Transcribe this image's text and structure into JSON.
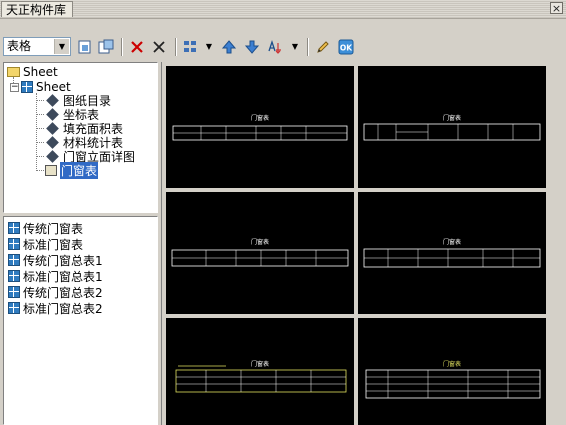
{
  "window": {
    "title": "天正构件库",
    "close_glyph": "×"
  },
  "toolbar": {
    "category_value": "表格",
    "buttons": [
      {
        "name": "import-icon"
      },
      {
        "name": "export-icon"
      },
      {
        "name": "delete-icon",
        "color": "#cc0000"
      },
      {
        "name": "cut-icon"
      },
      {
        "name": "grid-view-icon"
      },
      {
        "name": "move-up-icon"
      },
      {
        "name": "move-down-icon"
      },
      {
        "name": "sort-az-icon"
      },
      {
        "name": "edit-pencil-icon"
      },
      {
        "name": "ok-icon",
        "label": "OK"
      }
    ]
  },
  "tree": {
    "root": "Sheet",
    "child": "Sheet",
    "items": [
      "图纸目录",
      "坐标表",
      "填充面积表",
      "材料统计表",
      "门窗立面详图",
      "门窗表"
    ],
    "selected": "门窗表"
  },
  "list": {
    "items": [
      "传统门窗表",
      "标准门窗表",
      "传统门窗总表1",
      "标准门窗总表1",
      "传统门窗总表2",
      "标准门窗总表2"
    ]
  },
  "previews": {
    "titles": [
      "门窗表",
      "门窗表",
      "门窗表",
      "门窗表",
      "门窗表",
      "门窗表"
    ]
  },
  "colors": {
    "selection": "#316ac5",
    "preview_bg": "#000000",
    "preview_line": "#ffffff",
    "preview_accent": "#e0e060"
  }
}
